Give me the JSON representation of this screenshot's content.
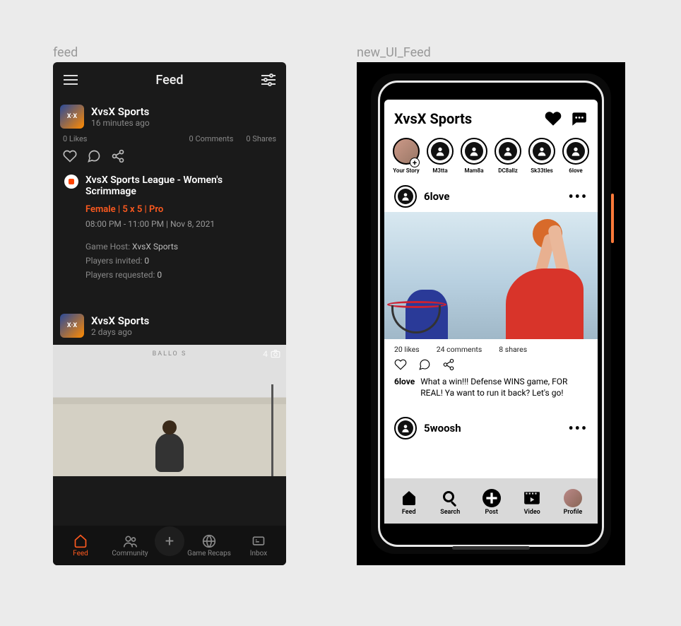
{
  "left_label": "feed",
  "right_label": "new_UI_Feed",
  "left": {
    "header_title": "Feed",
    "post1": {
      "name": "XvsX Sports",
      "age": "16 minutes ago",
      "likes": "0 Likes",
      "comments": "0 Comments",
      "shares": "0 Shares"
    },
    "event": {
      "title": "XvsX Sports League - Women's Scrimmage",
      "tags": "Female | 5 x 5 | Pro",
      "time": "08:00 PM - 11:00 PM | Nov 8, 2021",
      "host_label": "Game Host: ",
      "host_value": "XvsX Sports",
      "invited_label": "Players invited: ",
      "invited_value": "0",
      "requested_label": "Players requested: ",
      "requested_value": "0"
    },
    "post2": {
      "name": "XvsX Sports",
      "age": "2 days ago",
      "photo_count": "4"
    },
    "tabs": {
      "feed": "Feed",
      "community": "Community",
      "recaps": "Game Recaps",
      "inbox": "Inbox"
    }
  },
  "right": {
    "title": "XvsX Sports",
    "stories": [
      {
        "label": "Your Story"
      },
      {
        "label": "M3tta"
      },
      {
        "label": "Mam8a"
      },
      {
        "label": "DC8allz"
      },
      {
        "label": "Sk33tles"
      },
      {
        "label": "6love"
      }
    ],
    "post1": {
      "user": "6love",
      "likes": "20 likes",
      "comments": "24 comments",
      "shares": "8 shares",
      "caption_user": "6love",
      "caption": "What a win!!! Defense WINS game, FOR REAL! Ya want to run it back? Let's go!"
    },
    "post2": {
      "user": "5woosh"
    },
    "tabs": {
      "feed": "Feed",
      "search": "Search",
      "post": "Post",
      "video": "Video",
      "profile": "Profile"
    }
  }
}
